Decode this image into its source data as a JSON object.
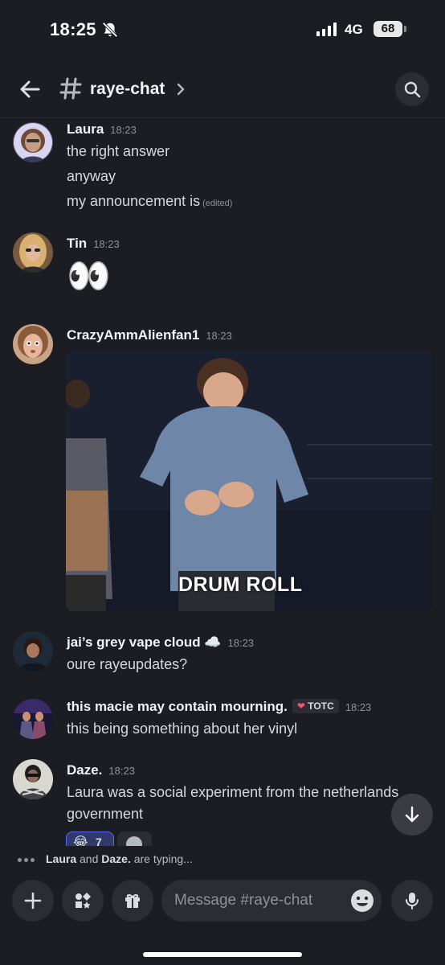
{
  "status_bar": {
    "time": "18:25",
    "network": "4G",
    "battery": "68",
    "icons": [
      "bell-slash-icon",
      "signal-bars-icon",
      "battery-icon"
    ]
  },
  "header": {
    "channel_name": "raye-chat",
    "icons": [
      "back-arrow-icon",
      "hash-icon",
      "chevron-right-icon",
      "search-icon"
    ]
  },
  "messages": [
    {
      "author": "Laura",
      "time": "18:23",
      "lines": [
        "the right answer",
        "anyway",
        "my announcement is"
      ],
      "edited": "(edited)"
    },
    {
      "author": "Tin",
      "time": "18:23",
      "lines": [
        "👀"
      ]
    },
    {
      "author": "CrazyAmmAlienfan1",
      "time": "18:23",
      "attachment": {
        "type": "gif",
        "caption": "DRUM ROLL"
      }
    },
    {
      "author": "jai’s grey vape cloud ☁️",
      "time": "18:23",
      "lines": [
        "oure rayeupdates?"
      ]
    },
    {
      "author": "this macie may contain mourning.",
      "role_tag": "TOTC",
      "role_heart": "❤",
      "time": "18:23",
      "lines": [
        "this being something about her vinyl"
      ]
    },
    {
      "author": "Daze.",
      "time": "18:23",
      "lines": [
        "Laura was a social experiment from the netherlands",
        "government"
      ],
      "reactions": [
        {
          "emoji": "😂",
          "count": "7"
        }
      ]
    }
  ],
  "typing_indicator": {
    "names": [
      "Laura",
      "Daze."
    ],
    "joiner": "and",
    "suffix": "are typing..."
  },
  "composer": {
    "placeholder": "Message #raye-chat",
    "icons": [
      "plus-icon",
      "apps-icon",
      "gift-icon",
      "emoji-icon",
      "microphone-icon"
    ]
  },
  "colors": {
    "background": "#1c1d22",
    "surface": "#2b2d33",
    "text": "#dbdee1",
    "muted": "#8e9297",
    "accent": "#5865f2"
  }
}
